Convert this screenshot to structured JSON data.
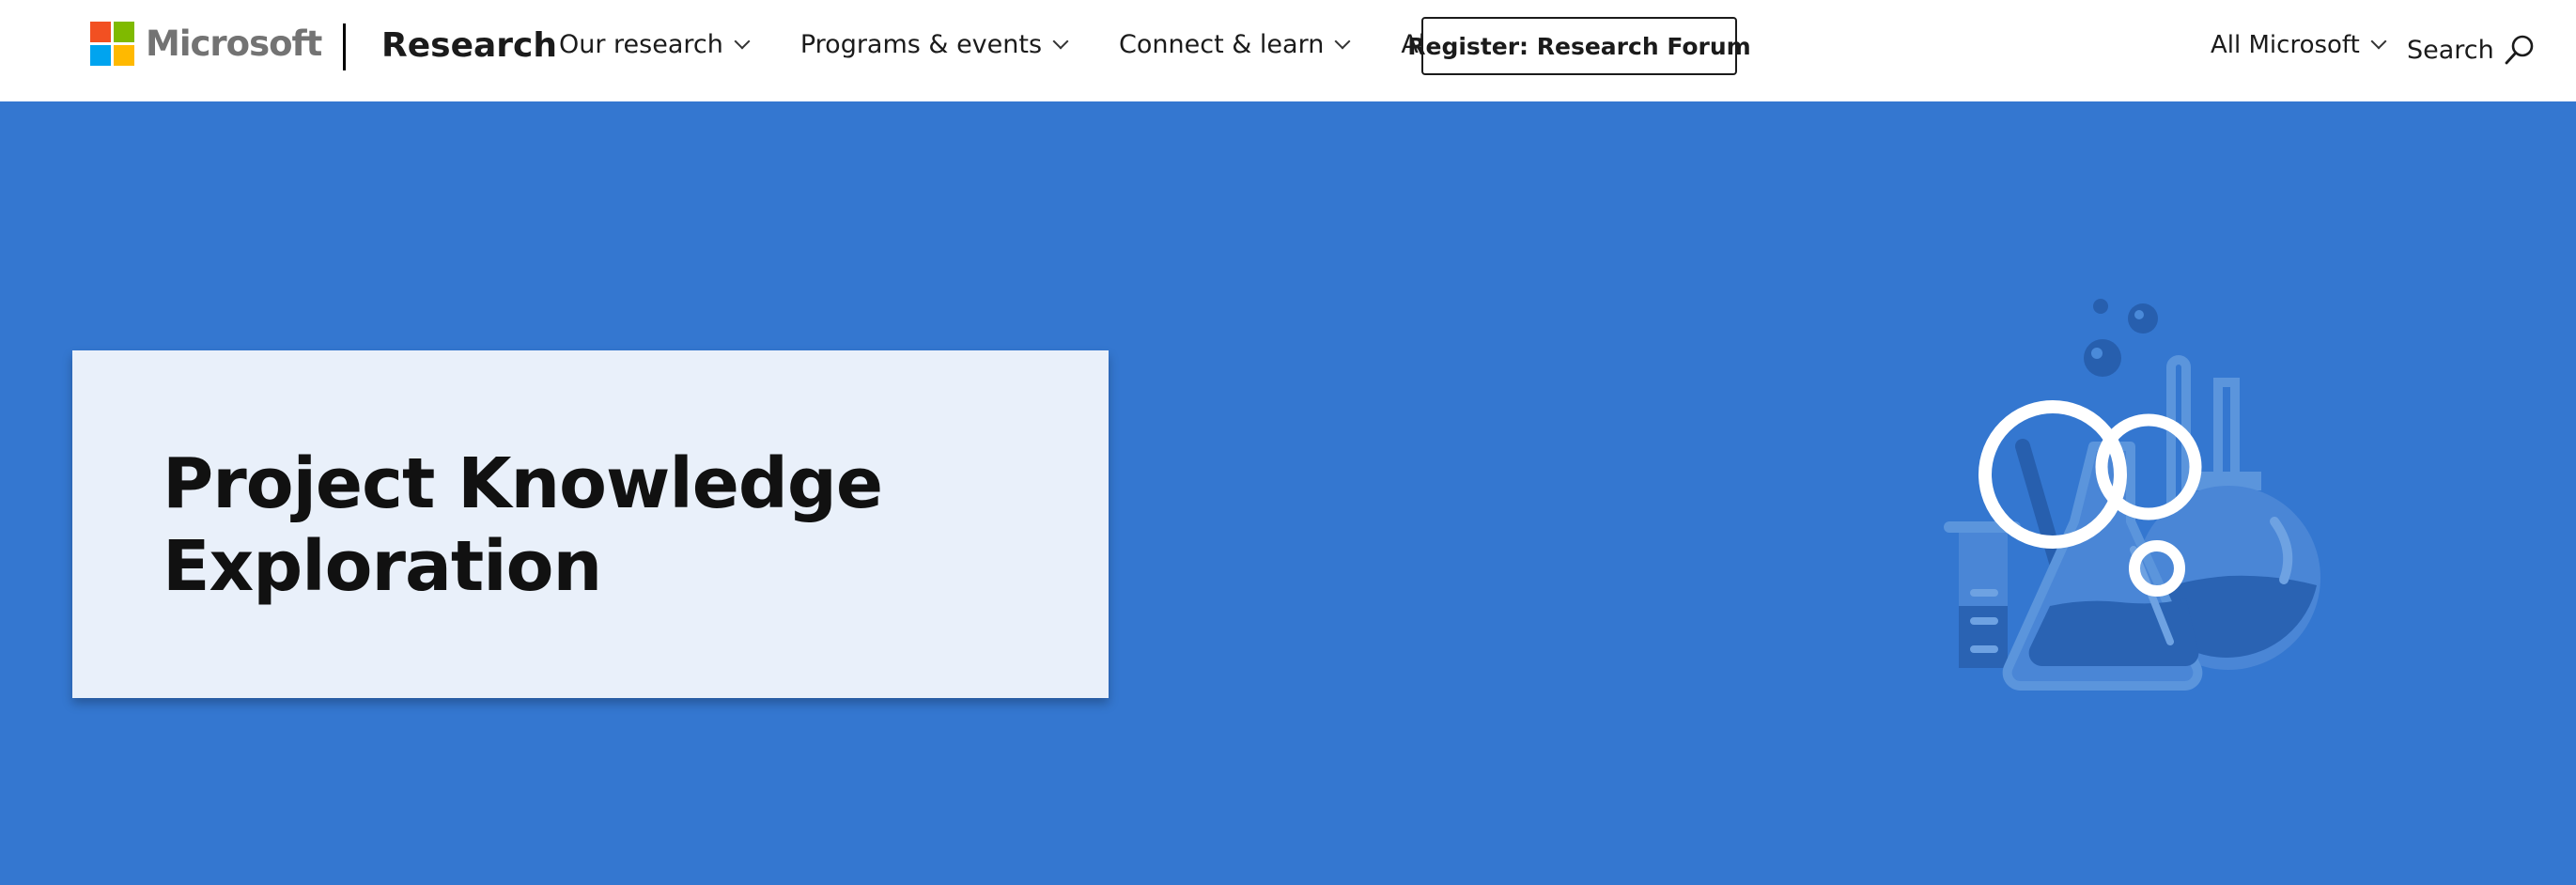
{
  "header": {
    "brand": "Microsoft",
    "section": "Research",
    "nav": [
      {
        "label": "Our research"
      },
      {
        "label": "Programs & events"
      },
      {
        "label": "Connect & learn"
      },
      {
        "label": "About"
      }
    ],
    "register_label": "Register: Research Forum",
    "all_microsoft_label": "All Microsoft",
    "search_label": "Search"
  },
  "hero": {
    "title": "Project Knowledge Exploration",
    "background_color": "#3477d0",
    "card_color": "#e9f0fa"
  },
  "logo_colors": [
    "#f25022",
    "#7fba00",
    "#00a4ef",
    "#ffb900"
  ],
  "icons": [
    "chevron-down-icon",
    "search-icon",
    "lab-glassware-icon"
  ]
}
